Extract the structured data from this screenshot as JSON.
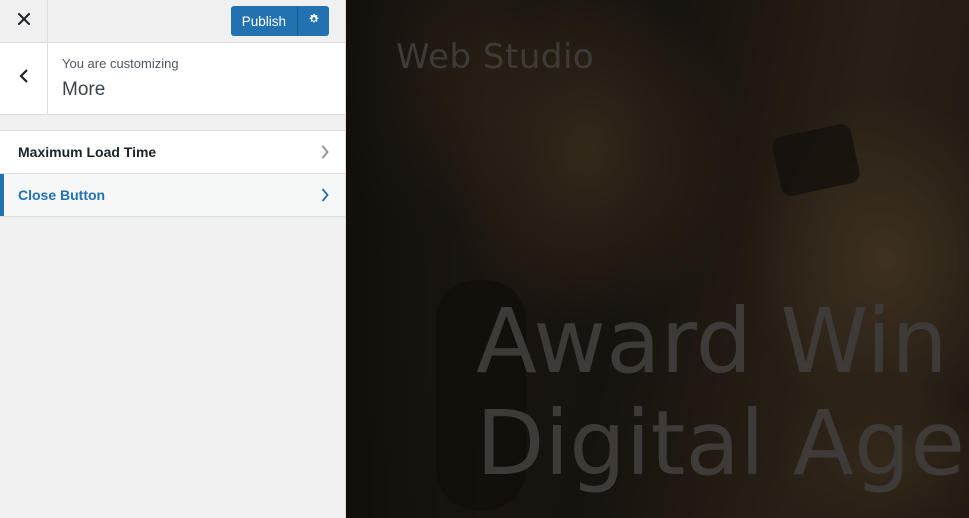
{
  "toolbar": {
    "close_icon": "close-icon",
    "publish_label": "Publish",
    "settings_icon": "gear-icon",
    "accent_color": "#2271b1"
  },
  "section": {
    "back_icon": "chevron-left-icon",
    "customizing_label": "You are customizing",
    "title": "More"
  },
  "panels": [
    {
      "label": "Maximum Load Time",
      "icon": "chevron-right-icon",
      "active": false
    },
    {
      "label": "Close Button",
      "icon": "chevron-right-icon",
      "active": true
    }
  ],
  "preview": {
    "site_title": "Web Studio",
    "hero_line_1": "Award Win",
    "hero_line_2": "Digital Age"
  }
}
